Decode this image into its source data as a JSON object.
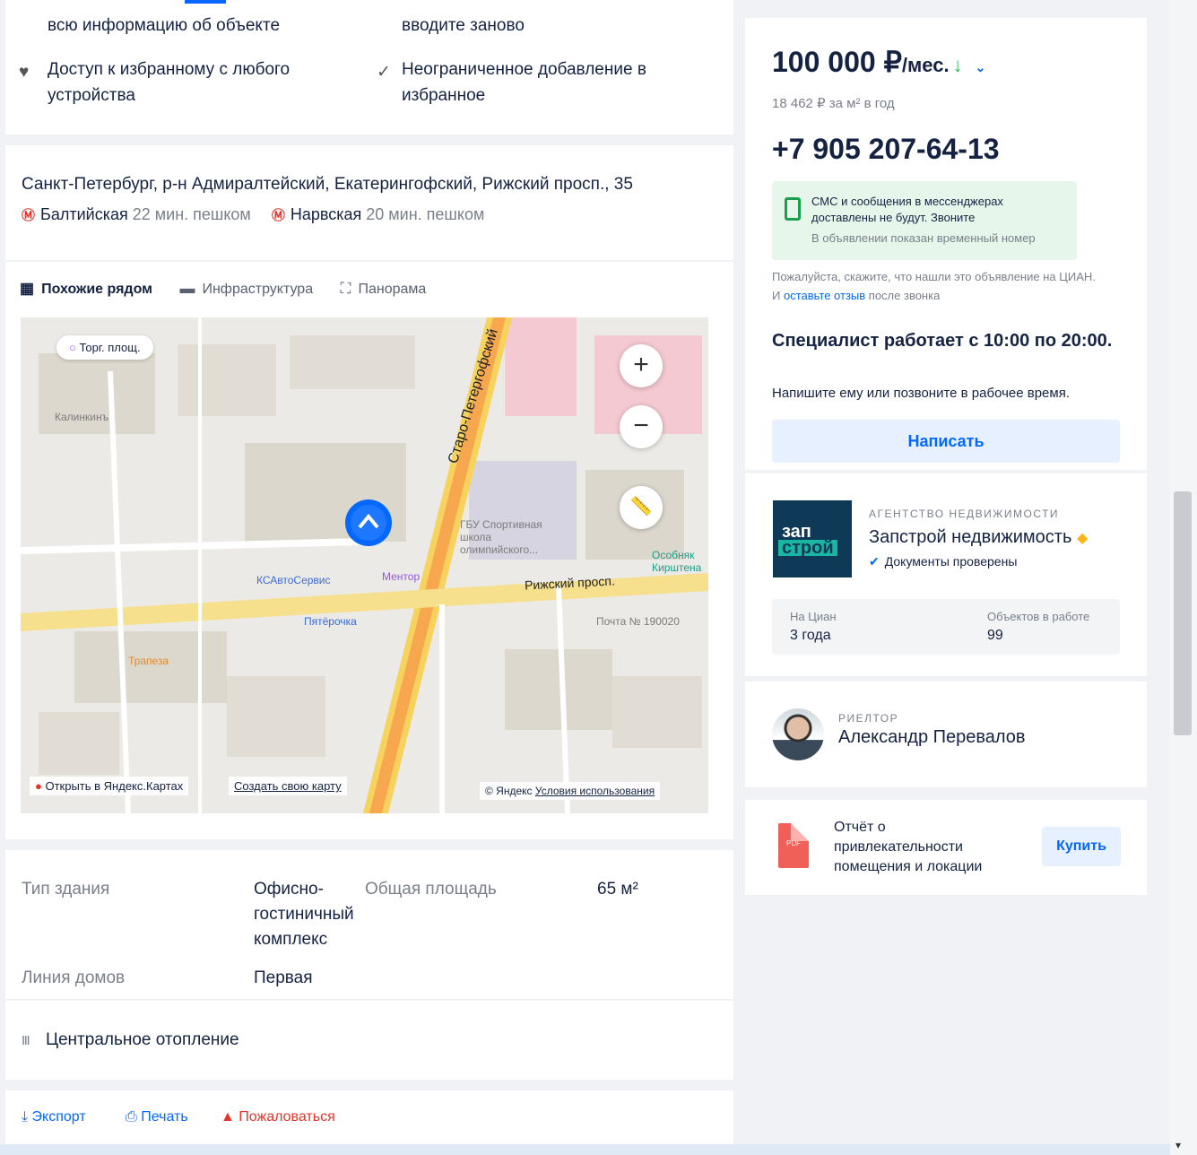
{
  "features": {
    "top_left": "всю информацию об объекте",
    "top_right": "вводите заново",
    "left": "Доступ к избранному с любого устройства",
    "right": "Неограниченное добавление в избранное"
  },
  "address": {
    "text": "Санкт-Петербург, р-н Адмиралтейский, Екатерингофский, Рижский просп., 35",
    "metro": [
      {
        "station": "Балтийская",
        "time": "22 мин. пешком"
      },
      {
        "station": "Нарвская",
        "time": "20 мин. пешком"
      }
    ]
  },
  "map_tabs": [
    "Похожие рядом",
    "Инфраструктура",
    "Панорама"
  ],
  "map": {
    "street1": "Старо-Петергофский",
    "street2": "Рижский просп.",
    "tag": "Торг. площ.",
    "open_label": "Открыть в Яндекс.Картах",
    "create_label": "Создать свою карту",
    "copyright": "© Яндекс",
    "terms": "Условия использования",
    "labels": {
      "a": "Калинкинъ",
      "b": "ГБУ Спортивная школа олимпийского...",
      "c": "КСАвтоСервис",
      "d": "Ментор",
      "e": "Пятёрочка",
      "f": "Почта № 190020",
      "g": "Трапеза",
      "h": "Особняк Кирштена"
    }
  },
  "info": {
    "building_type_label": "Тип здания",
    "building_type_value": "Офисно-гостиничный комплекс",
    "area_label": "Общая площадь",
    "area_value": "65 м²",
    "line_label": "Линия домов",
    "line_value": "Первая",
    "heating": "Центральное отопление"
  },
  "actions": {
    "export": "Экспорт",
    "print": "Печать",
    "complain": "Пожаловаться"
  },
  "offer": {
    "price": "100 000 ₽",
    "unit": "/мес.",
    "sub": "18 462 ₽ за м² в год",
    "phone": "+7 905 207-64-13",
    "notice1": "СМС и сообщения в мессенджерах доставлены не будут. Звоните",
    "notice2": "В объявлении показан временный номер",
    "ask_pre": "Пожалуйста, скажите, что нашли это объявление на ЦИАН. И ",
    "ask_link": "оставьте отзыв",
    "ask_post": " после звонка",
    "work": "Специалист работает с 10:00 по 20:00.",
    "worknote": "Напишите ему или позвоните в рабочее время.",
    "write_btn": "Написать"
  },
  "agency": {
    "logo1": "зап",
    "logo2": "строй",
    "type": "АГЕНТСТВО НЕДВИЖИМОСТИ",
    "name": "Запстрой недвижимость",
    "docs": "Документы проверены",
    "stat1_label": "На Циан",
    "stat1_value": "3 года",
    "stat2_label": "Объектов в работе",
    "stat2_value": "99"
  },
  "realtor": {
    "type": "РИЕЛТОР",
    "name": "Александр Перевалов"
  },
  "report": {
    "text": "Отчёт о привлекательности помещения и локации",
    "buy": "Купить",
    "pdf": "PDF"
  },
  "colors": {
    "accent": "#0468ff",
    "metro": "#e5332a",
    "green": "#2dbe4d"
  }
}
